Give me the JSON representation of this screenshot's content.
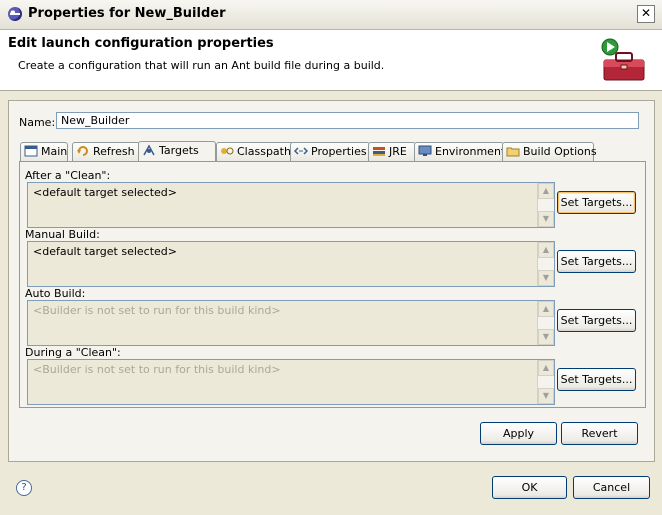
{
  "window": {
    "title": "Properties for New_Builder",
    "close_glyph": "✕"
  },
  "banner": {
    "heading": "Edit launch configuration properties",
    "description": "Create a configuration that will run an Ant build file during a build.",
    "icon": "toolbox-run-icon"
  },
  "name_field": {
    "label": "Name:",
    "value": "New_Builder"
  },
  "tabs": [
    {
      "label": "Main",
      "icon": "main-icon"
    },
    {
      "label": "Refresh",
      "icon": "refresh-icon"
    },
    {
      "label": "Targets",
      "icon": "targets-icon",
      "active": true
    },
    {
      "label": "Classpath",
      "icon": "classpath-icon"
    },
    {
      "label": "Properties",
      "icon": "properties-icon"
    },
    {
      "label": "JRE",
      "icon": "jre-icon"
    },
    {
      "label": "Environment",
      "icon": "environment-icon"
    },
    {
      "label": "Build Options",
      "icon": "build-options-icon"
    }
  ],
  "groups": [
    {
      "label": "After a \"Clean\":",
      "text": "<default target selected>",
      "enabled": true,
      "button": "Set Targets..."
    },
    {
      "label": "Manual Build:",
      "text": "<default target selected>",
      "enabled": true,
      "button": "Set Targets..."
    },
    {
      "label": "Auto Build:",
      "text": "<Builder is not set to run for this build kind>",
      "enabled": false,
      "button": "Set Targets..."
    },
    {
      "label": "During a \"Clean\":",
      "text": "<Builder is not set to run for this build kind>",
      "enabled": false,
      "button": "Set Targets..."
    }
  ],
  "buttons": {
    "apply": "Apply",
    "revert": "Revert",
    "ok": "OK",
    "cancel": "Cancel"
  },
  "help_glyph": "?"
}
